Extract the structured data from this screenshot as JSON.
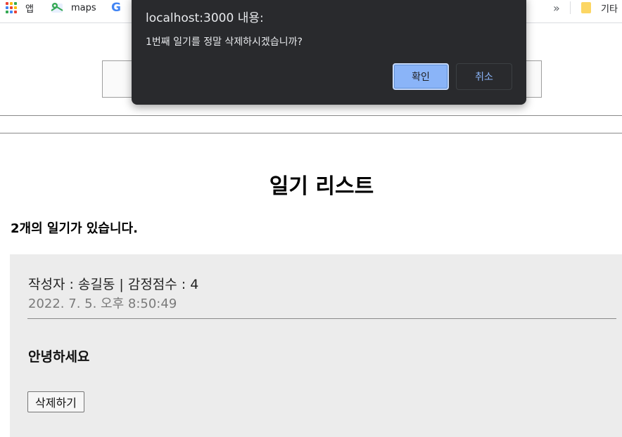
{
  "bookmarks": {
    "apps_label": "앱",
    "maps_label": "maps",
    "more_label": "»",
    "folder_label": "기타",
    "icons": [
      "apps-grid-icon",
      "maps-icon",
      "google-icon",
      "folder-icon"
    ],
    "apps_colors": [
      "#ea4335",
      "#fbbc04",
      "#34a853",
      "#4285f4",
      "#ea4335",
      "#fbbc04",
      "#34a853",
      "#4285f4",
      "#ea4335"
    ]
  },
  "dialog": {
    "title": "localhost:3000 내용:",
    "message": "1번째 일기를 정말 삭제하시겠습니까?",
    "confirm_label": "확인",
    "cancel_label": "취소"
  },
  "diary_list": {
    "title": "일기 리스트",
    "count_text": "2개의 일기가 있습니다.",
    "items": [
      {
        "info": "작성자 : 송길동 | 감정점수 : 4",
        "date": "2022. 7. 5. 오후 8:50:49",
        "content": "안녕하세요",
        "delete_label": "삭제하기"
      }
    ]
  },
  "colors": {
    "dialog_bg": "#292a2d",
    "confirm_bg": "#8ab4f8",
    "item_bg": "#ececec"
  }
}
